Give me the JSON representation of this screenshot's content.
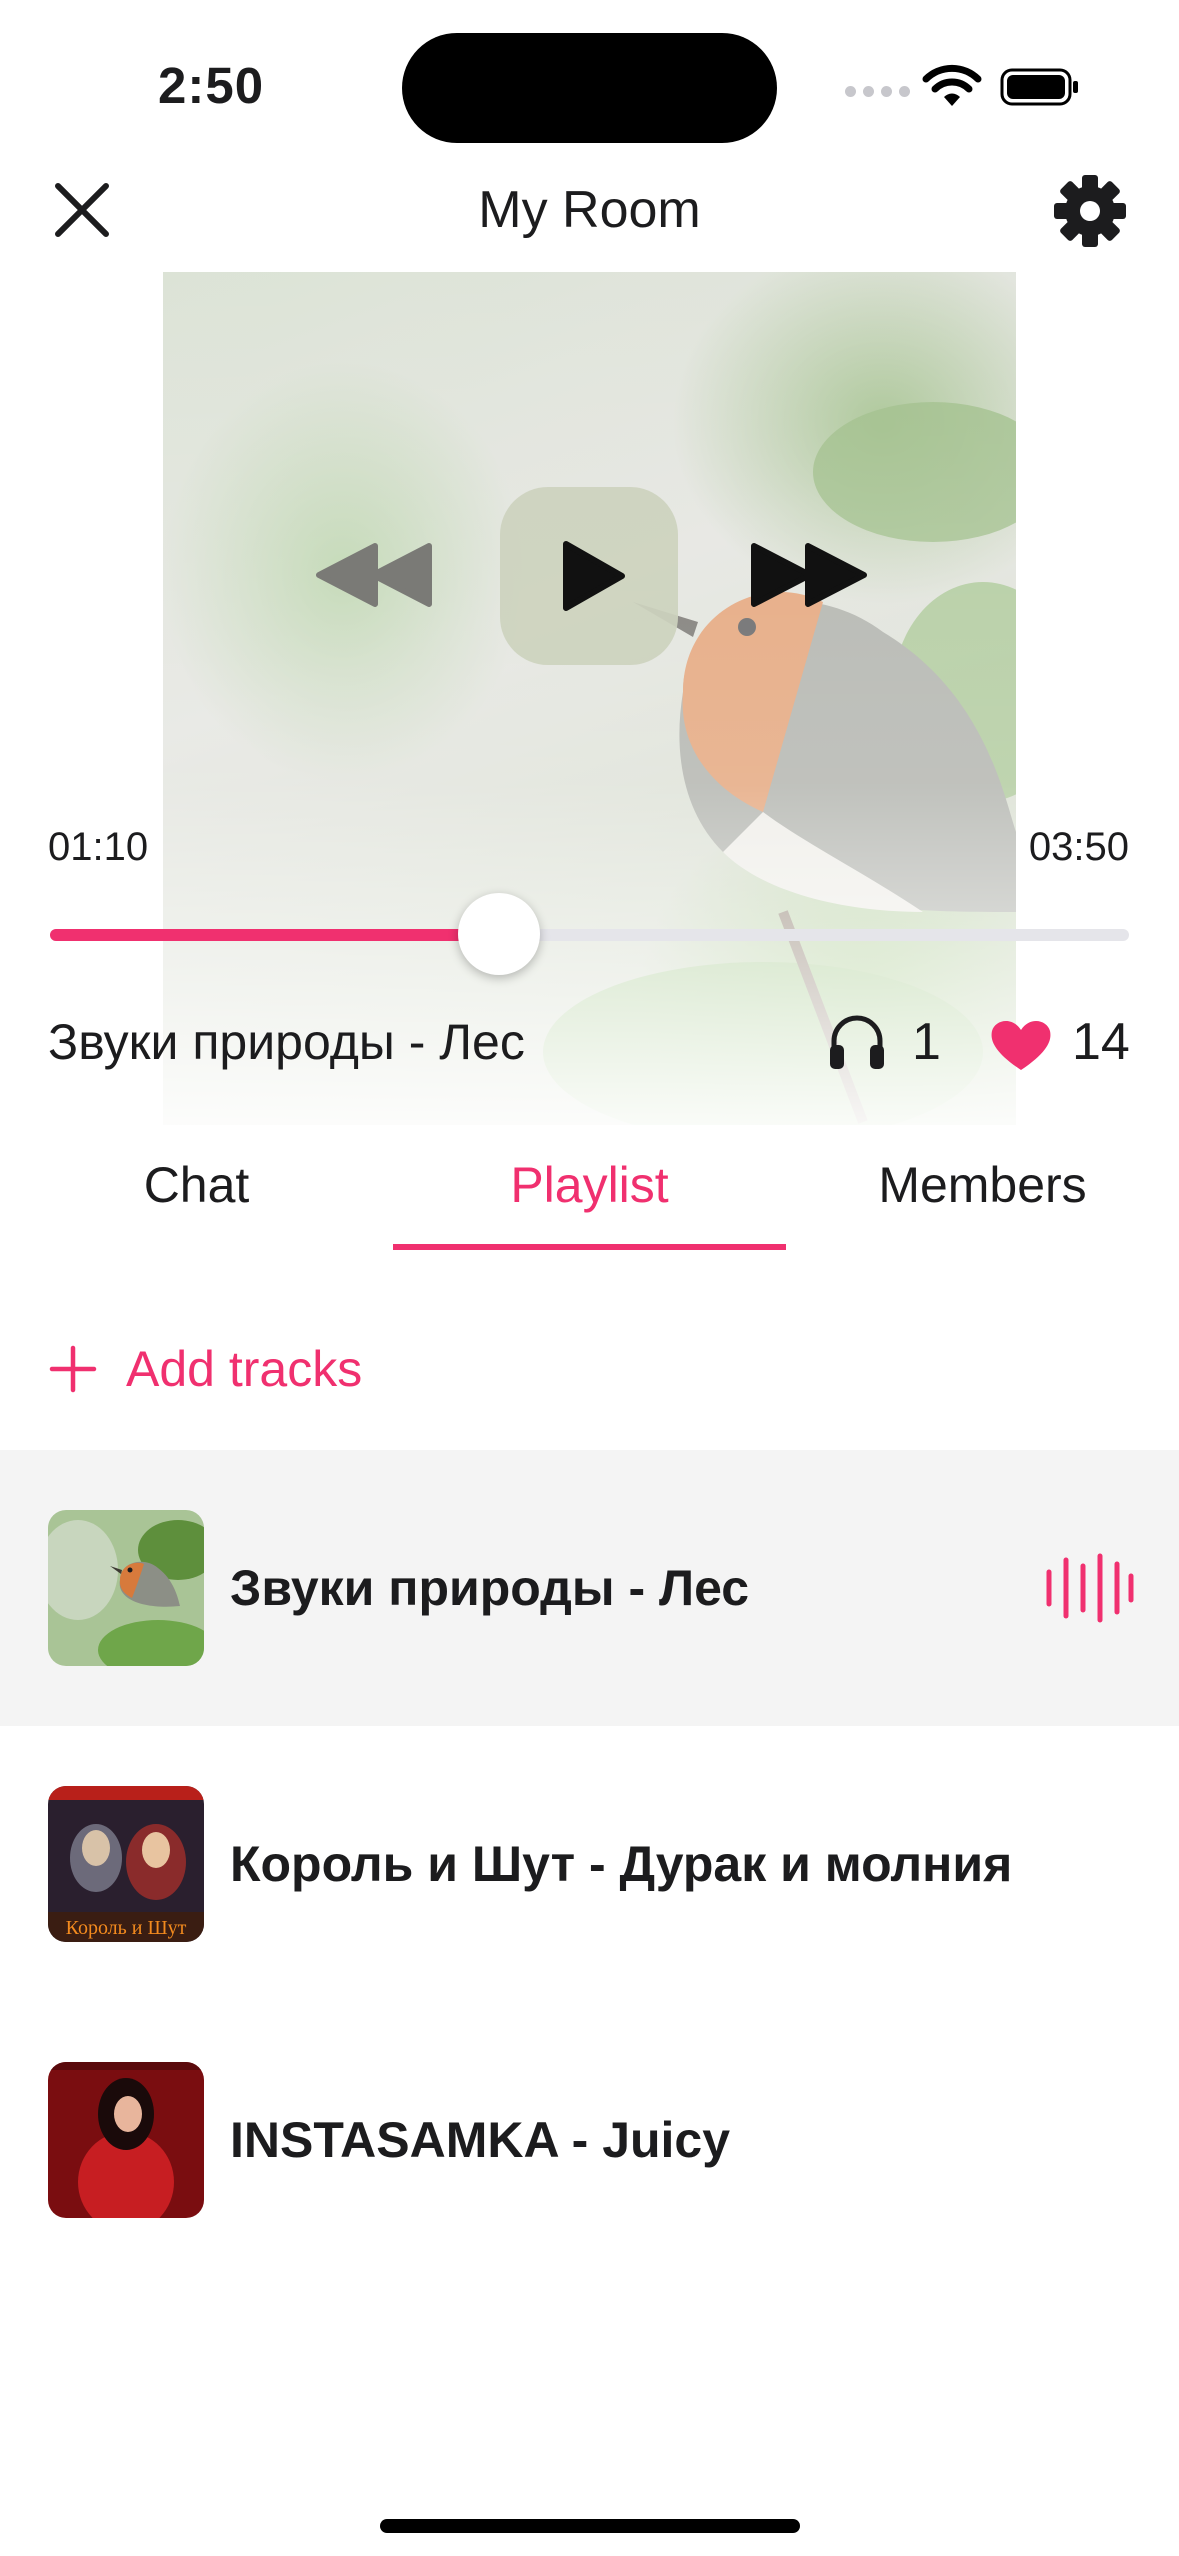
{
  "status_bar": {
    "time": "2:50"
  },
  "header": {
    "title": "My Room"
  },
  "player": {
    "current_time": "01:10",
    "total_time": "03:50",
    "progress": 0.416,
    "track_title": "Звуки природы - Лес",
    "listeners": "1",
    "likes": "14"
  },
  "tabs": [
    {
      "label": "Chat",
      "active": false
    },
    {
      "label": "Playlist",
      "active": true
    },
    {
      "label": "Members",
      "active": false
    }
  ],
  "add_tracks_label": "Add tracks",
  "playlist": [
    {
      "title": "Звуки природы - Лес",
      "playing": true,
      "cover": "robin-bird-cover"
    },
    {
      "title": "Король и Шут - Дурак и молния",
      "playing": false,
      "cover": "band-album-cover",
      "cover_text": "Король и Шут"
    },
    {
      "title": "INSTASAMKA - Juicy",
      "playing": false,
      "cover": "artist-red-cover"
    }
  ],
  "colors": {
    "accent": "#f0306f",
    "text": "#1c1c1e",
    "current_row_bg": "#f4f4f4"
  }
}
